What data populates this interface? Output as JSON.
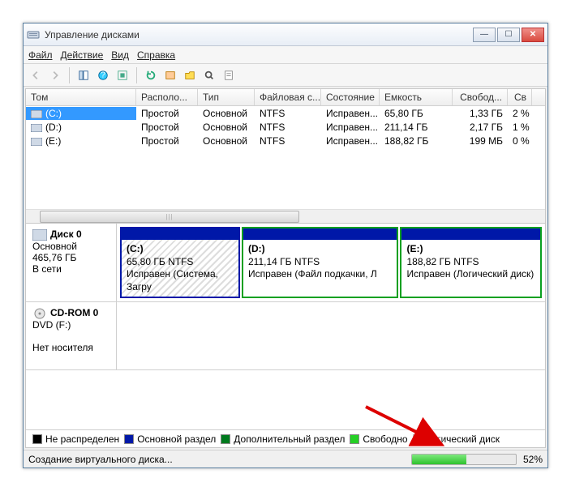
{
  "titlebar": {
    "title": "Управление дисками"
  },
  "menu": {
    "file": "Файл",
    "action": "Действие",
    "view": "Вид",
    "help": "Справка"
  },
  "columns": {
    "vol": "Том",
    "layout": "Располо...",
    "type": "Тип",
    "fs": "Файловая с...",
    "status": "Состояние",
    "capacity": "Емкость",
    "free": "Свобод...",
    "pct": "Св"
  },
  "volumes": [
    {
      "name": "(C:)",
      "layout": "Простой",
      "type": "Основной",
      "fs": "NTFS",
      "status": "Исправен...",
      "capacity": "65,80 ГБ",
      "free": "1,33 ГБ",
      "pct": "2 %"
    },
    {
      "name": "(D:)",
      "layout": "Простой",
      "type": "Основной",
      "fs": "NTFS",
      "status": "Исправен...",
      "capacity": "211,14 ГБ",
      "free": "2,17 ГБ",
      "pct": "1 %"
    },
    {
      "name": "(E:)",
      "layout": "Простой",
      "type": "Основной",
      "fs": "NTFS",
      "status": "Исправен...",
      "capacity": "188,82 ГБ",
      "free": "199 МБ",
      "pct": "0 %"
    }
  ],
  "disk0": {
    "name": "Диск 0",
    "type": "Основной",
    "size": "465,76 ГБ",
    "state": "В сети",
    "p1": {
      "label": "(C:)",
      "size": "65,80 ГБ NTFS",
      "status": "Исправен (Система, Загру"
    },
    "p2": {
      "label": "(D:)",
      "size": "211,14 ГБ NTFS",
      "status": "Исправен (Файл подкачки, Л"
    },
    "p3": {
      "label": "(E:)",
      "size": "188,82 ГБ NTFS",
      "status": "Исправен (Логический диск)"
    }
  },
  "cdrom": {
    "name": "CD-ROM 0",
    "drive": "DVD (F:)",
    "state": "Нет носителя"
  },
  "legend": {
    "unalloc": "Не распределен",
    "primary": "Основной раздел",
    "extended": "Дополнительный раздел",
    "free": "Свободно",
    "logical": "Логический диск"
  },
  "colors": {
    "unalloc": "#000000",
    "primary": "#0018a8",
    "extended": "#007a1e",
    "free": "#25d025",
    "logical": "#1e3fff"
  },
  "status": {
    "text": "Создание виртуального диска...",
    "pct_label": "52%",
    "pct": 52
  }
}
